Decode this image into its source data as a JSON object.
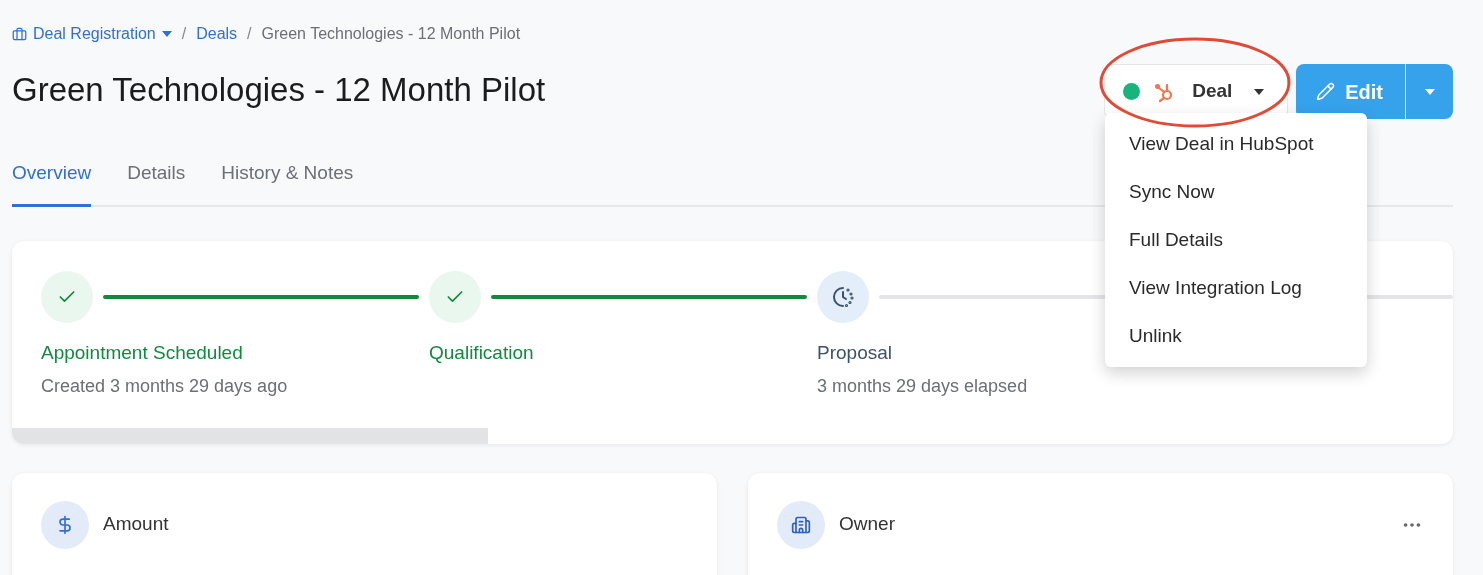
{
  "breadcrumb": [
    {
      "label": "Deal Registration",
      "kind": "dropdown"
    },
    {
      "label": "Deals",
      "kind": "link",
      "separator": "/"
    },
    {
      "label": "Green Technologies - 12 Month Pilot",
      "kind": "current",
      "separator": "/"
    }
  ],
  "title": "Green Technologies - 12 Month Pilot",
  "integration": {
    "connected": true,
    "label": "Deal"
  },
  "edit_button": {
    "label": "Edit"
  },
  "menu": {
    "items": [
      "View Deal in HubSpot",
      "Sync Now",
      "Full Details",
      "View Integration Log",
      "Unlink"
    ]
  },
  "tabs": [
    {
      "label": "Overview",
      "selected": true
    },
    {
      "label": "Details",
      "selected": false
    },
    {
      "label": "History & Notes",
      "selected": false
    }
  ],
  "stages": [
    {
      "name": "Appointment Scheduled",
      "note": "Created 3 months 29 days ago",
      "kind": "done"
    },
    {
      "name": "Qualification",
      "kind": "done"
    },
    {
      "name": "Proposal",
      "note": "3 months 29 days elapsed",
      "kind": "current"
    }
  ],
  "stage_progress": {
    "level": 0.33
  },
  "cards": [
    {
      "title": "Amount",
      "kind": "amount",
      "menu": false
    },
    {
      "title": "Owner",
      "kind": "owner",
      "menu": true
    }
  ]
}
